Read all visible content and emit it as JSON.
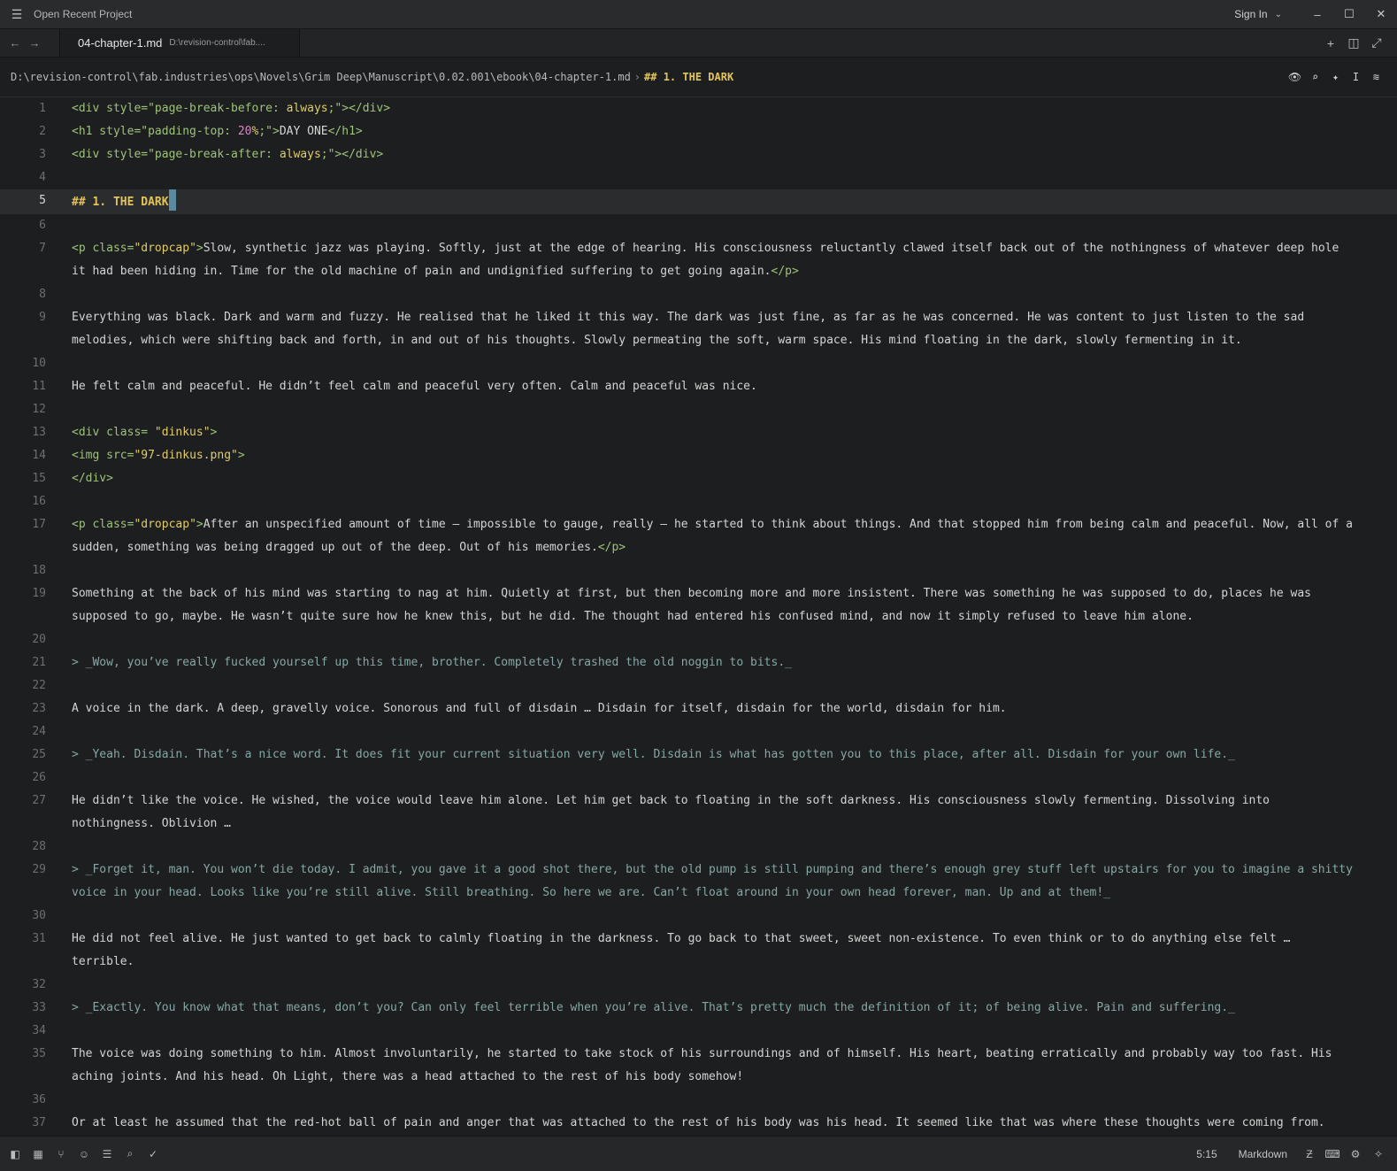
{
  "window": {
    "title": "Open Recent Project",
    "sign_in": "Sign In"
  },
  "tab": {
    "name": "04-chapter-1.md",
    "path": "D:\\revision-control\\fab...."
  },
  "breadcrumb": {
    "path": "D:\\revision-control\\fab.industries\\ops\\Novels\\Grim Deep\\Manuscript\\0.02.001\\ebook\\04-chapter-1.md",
    "separator": "›",
    "heading": "## 1. THE DARK"
  },
  "editor": {
    "active_line": 5,
    "lines": [
      {
        "n": "1",
        "parts": [
          [
            "tag",
            "<div style=\""
          ],
          [
            "tag",
            "page-break-before: "
          ],
          [
            "str",
            "always"
          ],
          [
            "tag",
            ";\"></div>"
          ]
        ]
      },
      {
        "n": "2",
        "parts": [
          [
            "tag",
            "<h1 style=\""
          ],
          [
            "tag",
            "padding-top: "
          ],
          [
            "num",
            "20"
          ],
          [
            "str",
            "%"
          ],
          [
            "tag",
            ";\">"
          ],
          [
            "text",
            "DAY ONE"
          ],
          [
            "tag",
            "</h1>"
          ]
        ]
      },
      {
        "n": "3",
        "parts": [
          [
            "tag",
            "<div style=\""
          ],
          [
            "tag",
            "page-break-after: "
          ],
          [
            "str",
            "always"
          ],
          [
            "tag",
            ";\"></div>"
          ]
        ]
      },
      {
        "n": "4",
        "parts": []
      },
      {
        "n": "5",
        "parts": [
          [
            "heading",
            "## 1. THE DARK"
          ]
        ]
      },
      {
        "n": "6",
        "parts": []
      },
      {
        "n": "7",
        "parts": [
          [
            "tag",
            "<p class="
          ],
          [
            "str",
            "\"dropcap\""
          ],
          [
            "tag",
            ">"
          ],
          [
            "text",
            "Slow, synthetic jazz was playing. Softly, just at the edge of hearing. His consciousness reluctantly clawed itself back out of the nothingness of whatever deep hole it had been hiding in. Time for the old machine of pain and undignified suffering to get going again."
          ],
          [
            "tag",
            "</p>"
          ]
        ]
      },
      {
        "n": "8",
        "parts": []
      },
      {
        "n": "9",
        "parts": [
          [
            "text",
            "Everything was black. Dark and warm and fuzzy. He realised that he liked it this way. The dark was just fine, as far as he was concerned. He was content to just listen to the sad melodies, which were shifting back and forth, in and out of his thoughts. Slowly permeating the soft, warm space. His mind floating in the dark, slowly fermenting in it."
          ]
        ]
      },
      {
        "n": "10",
        "parts": []
      },
      {
        "n": "11",
        "parts": [
          [
            "text",
            "He felt calm and peaceful. He didn’t feel calm and peaceful very often. Calm and peaceful was nice."
          ]
        ]
      },
      {
        "n": "12",
        "parts": []
      },
      {
        "n": "13",
        "parts": [
          [
            "tag",
            "<div class= "
          ],
          [
            "str",
            "\"dinkus\""
          ],
          [
            "tag",
            ">"
          ]
        ]
      },
      {
        "n": "14",
        "parts": [
          [
            "tag",
            "<img src="
          ],
          [
            "str",
            "\"97-dinkus.png\""
          ],
          [
            "tag",
            ">"
          ]
        ]
      },
      {
        "n": "15",
        "parts": [
          [
            "tag",
            "</div>"
          ]
        ]
      },
      {
        "n": "16",
        "parts": []
      },
      {
        "n": "17",
        "parts": [
          [
            "tag",
            "<p class="
          ],
          [
            "str",
            "\"dropcap\""
          ],
          [
            "tag",
            ">"
          ],
          [
            "text",
            "After an unspecified amount of time — impossible to gauge, really — he started to think about things. And that stopped him from being calm and peaceful. Now, all of a sudden, something was being dragged up out of the deep. Out of his memories."
          ],
          [
            "tag",
            "</p>"
          ]
        ]
      },
      {
        "n": "18",
        "parts": []
      },
      {
        "n": "19",
        "parts": [
          [
            "text",
            "Something at the back of his mind was starting to nag at him. Quietly at first, but then becoming more and more insistent. There was something he was supposed to do, places he was supposed to go, maybe. He wasn’t quite sure how he knew this, but he did. The thought had entered his confused mind, and now it simply refused to leave him alone."
          ]
        ]
      },
      {
        "n": "20",
        "parts": []
      },
      {
        "n": "21",
        "parts": [
          [
            "quote",
            "> _Wow, you’ve really fucked yourself up this time, brother. Completely trashed the old noggin to bits._"
          ]
        ]
      },
      {
        "n": "22",
        "parts": []
      },
      {
        "n": "23",
        "parts": [
          [
            "text",
            "A voice in the dark. A deep, gravelly voice. Sonorous and full of disdain … Disdain for itself, disdain for the world, disdain for him."
          ]
        ]
      },
      {
        "n": "24",
        "parts": []
      },
      {
        "n": "25",
        "parts": [
          [
            "quote",
            "> _Yeah. Disdain. That’s a nice word. It does fit your current situation very well. Disdain is what has gotten you to this place, after all. Disdain for your own life._"
          ]
        ]
      },
      {
        "n": "26",
        "parts": []
      },
      {
        "n": "27",
        "parts": [
          [
            "text",
            "He didn’t like the voice. He wished, the voice would leave him alone. Let him get back to floating in the soft darkness. His consciousness slowly fermenting. Dissolving into nothingness. Oblivion …"
          ]
        ]
      },
      {
        "n": "28",
        "parts": []
      },
      {
        "n": "29",
        "parts": [
          [
            "quote",
            "> _Forget it, man. You won’t die today. I admit, you gave it a good shot there, but the old pump is still pumping and there’s enough grey stuff left upstairs for you to imagine a shitty voice in your head. Looks like you’re still alive. Still breathing. So here we are. Can’t float around in your own head forever, man. Up and at them!_"
          ]
        ]
      },
      {
        "n": "30",
        "parts": []
      },
      {
        "n": "31",
        "parts": [
          [
            "text",
            "He did not feel alive. He just wanted to get back to calmly floating in the darkness. To go back to that sweet, sweet non-existence. To even think or to do anything else felt … terrible."
          ]
        ]
      },
      {
        "n": "32",
        "parts": []
      },
      {
        "n": "33",
        "parts": [
          [
            "quote",
            "> _Exactly. You know what that means, don’t you? Can only feel terrible when you’re alive. That’s pretty much the definition of it; of being alive. Pain and suffering._"
          ]
        ]
      },
      {
        "n": "34",
        "parts": []
      },
      {
        "n": "35",
        "parts": [
          [
            "text",
            "The voice was doing something to him. Almost involuntarily, he started to take stock of his surroundings and of himself. His heart, beating erratically and probably way too fast. His aching joints. And his head. Oh Light, there was a head attached to the rest of his body somehow!"
          ]
        ]
      },
      {
        "n": "36",
        "parts": []
      },
      {
        "n": "37",
        "parts": [
          [
            "text",
            "Or at least he assumed that the red-hot ball of pain and anger that was attached to the rest of his body was his head. It seemed like that was where these thoughts were coming from. That’s a head, right? Where your thoughts are coming from?"
          ]
        ]
      }
    ]
  },
  "status": {
    "cursor_position": "5:15",
    "language": "Markdown"
  },
  "icons": {
    "titlebar": [
      "menu-icon",
      "chevron-down-icon",
      "minimize-icon",
      "maximize-icon",
      "close-icon"
    ],
    "tabbar": [
      "back-arrow-icon",
      "forward-arrow-icon",
      "plus-icon",
      "split-pane-icon",
      "fullscreen-icon"
    ],
    "breadcrumb_tools": [
      "eye-icon",
      "search-icon",
      "sparkle-icon",
      "text-cursor-icon",
      "sliders-icon"
    ],
    "statusbar_left": [
      "panel-toggle-icon",
      "project-panel-icon",
      "git-branch-icon",
      "collaborators-icon",
      "outline-icon",
      "search-icon",
      "check-icon"
    ],
    "statusbar_right": [
      "vim-mode-icon",
      "terminal-icon",
      "debug-icon",
      "assistant-icon"
    ]
  }
}
